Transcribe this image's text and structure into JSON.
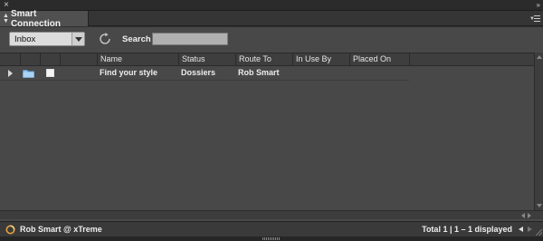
{
  "window": {
    "close_glyph": "×",
    "collapse_glyph": "»"
  },
  "panel": {
    "tab_title": "Smart Connection"
  },
  "toolbar": {
    "view_selected": "Inbox",
    "search_label": "Search",
    "search_value": ""
  },
  "table": {
    "columns": [
      "Name",
      "Status",
      "Route To",
      "In Use By",
      "Placed On"
    ],
    "rows": [
      {
        "name": "Find your style",
        "status": "Dossiers",
        "route_to": "Rob Smart",
        "in_use_by": "",
        "placed_on": ""
      }
    ]
  },
  "status": {
    "user": "Rob Smart @ xTreme",
    "total": "Total 1 | 1 – 1 displayed"
  },
  "colors": {
    "panel_bg": "#484848",
    "header_bg": "#3e3e3e",
    "folder_blue": "#8fc3ef",
    "status_icon_orange": "#e8a23a"
  },
  "icons": [
    "close-icon",
    "collapse-icon",
    "panel-menu-icon",
    "refresh-icon",
    "expand-arrow-icon",
    "folder-icon",
    "checkbox",
    "connection-status-icon",
    "prev-page-icon",
    "next-page-icon"
  ]
}
